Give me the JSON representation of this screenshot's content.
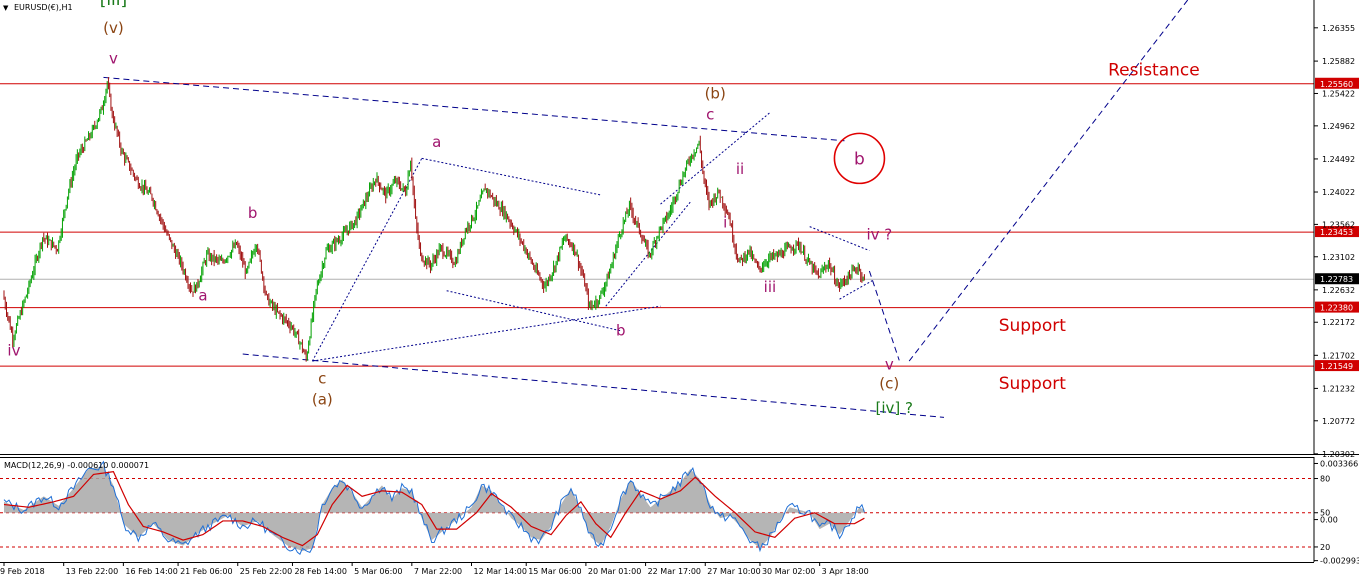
{
  "chart_data": {
    "type": "candlestick",
    "symbol_label": "EURUSD(€),H1",
    "colors": {
      "up_candle": "#00a000",
      "down_candle": "#a01010",
      "price_line": "#b0b0b0",
      "level_line": "#d00000",
      "trend_line": "#00008b",
      "wave_magenta": "#a0156e",
      "wave_brown": "#8b4513",
      "wave_green": "#1a7a1a",
      "macd_signal": "#d00000",
      "macd_main": "#1f6fd6",
      "macd_hist": "#a8a8a8"
    },
    "price_axis": {
      "range": [
        1.203,
        1.2675
      ],
      "ticks": [
        "1.26355",
        "1.25882",
        "1.25422",
        "1.24962",
        "1.24492",
        "1.24022",
        "1.23562",
        "1.23102",
        "1.22632",
        "1.22172",
        "1.21702",
        "1.21232",
        "1.20772",
        "1.20302"
      ]
    },
    "current_price": 1.22783,
    "current_price_label": "1.22783",
    "levels": [
      {
        "price": 1.2556,
        "label": "1.25560"
      },
      {
        "price": 1.23453,
        "label": "1.23453"
      },
      {
        "price": 1.2238,
        "label": "1.22380"
      },
      {
        "price": 1.21549,
        "label": "1.21549"
      }
    ],
    "zone_labels": [
      {
        "text": "Resistance",
        "price": 1.2568,
        "bar": 222
      },
      {
        "text": "Support",
        "price": 1.2205,
        "bar": 200
      },
      {
        "text": "Support",
        "price": 1.2122,
        "bar": 200
      }
    ],
    "time_axis": {
      "total_bars": 264,
      "ticks": [
        {
          "label": "9 Feb 2018",
          "bar": 0
        },
        {
          "label": "13 Feb 22:00",
          "bar": 12
        },
        {
          "label": "16 Feb 14:00",
          "bar": 24
        },
        {
          "label": "21 Feb 06:00",
          "bar": 35
        },
        {
          "label": "25 Feb 22:00",
          "bar": 47
        },
        {
          "label": "28 Feb 14:00",
          "bar": 58
        },
        {
          "label": "5 Mar 06:00",
          "bar": 70
        },
        {
          "label": "7 Mar 22:00",
          "bar": 82
        },
        {
          "label": "12 Mar 14:00",
          "bar": 94
        },
        {
          "label": "15 Mar 06:00",
          "bar": 105
        },
        {
          "label": "20 Mar 01:00",
          "bar": 117
        },
        {
          "label": "22 Mar 17:00",
          "bar": 129
        },
        {
          "label": "27 Mar 10:00",
          "bar": 141
        },
        {
          "label": "30 Mar 02:00",
          "bar": 152
        },
        {
          "label": "3 Apr 18:00",
          "bar": 164
        }
      ]
    },
    "price_path": [
      [
        0,
        1.2258
      ],
      [
        2,
        1.2195
      ],
      [
        5,
        1.2262
      ],
      [
        8,
        1.2338
      ],
      [
        11,
        1.2322
      ],
      [
        13,
        1.2398
      ],
      [
        15,
        1.2452
      ],
      [
        18,
        1.2488
      ],
      [
        20,
        1.2522
      ],
      [
        21,
        1.2558
      ],
      [
        22,
        1.2512
      ],
      [
        24,
        1.2458
      ],
      [
        27,
        1.2418
      ],
      [
        30,
        1.2395
      ],
      [
        33,
        1.2342
      ],
      [
        36,
        1.2298
      ],
      [
        38,
        1.2262
      ],
      [
        39,
        1.2268
      ],
      [
        41,
        1.2312
      ],
      [
        44,
        1.2302
      ],
      [
        47,
        1.2328
      ],
      [
        49,
        1.2286
      ],
      [
        51,
        1.2332
      ],
      [
        53,
        1.2252
      ],
      [
        55,
        1.2232
      ],
      [
        58,
        1.2212
      ],
      [
        60,
        1.2185
      ],
      [
        61,
        1.2165
      ],
      [
        63,
        1.2262
      ],
      [
        65,
        1.2318
      ],
      [
        68,
        1.2338
      ],
      [
        71,
        1.2362
      ],
      [
        73,
        1.2392
      ],
      [
        75,
        1.2422
      ],
      [
        77,
        1.2398
      ],
      [
        79,
        1.2418
      ],
      [
        81,
        1.2402
      ],
      [
        82,
        1.2448
      ],
      [
        83,
        1.2362
      ],
      [
        84,
        1.2312
      ],
      [
        86,
        1.2298
      ],
      [
        88,
        1.2322
      ],
      [
        91,
        1.2302
      ],
      [
        93,
        1.2348
      ],
      [
        95,
        1.2372
      ],
      [
        97,
        1.2408
      ],
      [
        99,
        1.2388
      ],
      [
        101,
        1.2372
      ],
      [
        103,
        1.2348
      ],
      [
        105,
        1.2322
      ],
      [
        107,
        1.2292
      ],
      [
        109,
        1.2268
      ],
      [
        111,
        1.2298
      ],
      [
        113,
        1.2338
      ],
      [
        115,
        1.2322
      ],
      [
        117,
        1.2272
      ],
      [
        118,
        1.2238
      ],
      [
        120,
        1.2252
      ],
      [
        122,
        1.2288
      ],
      [
        124,
        1.2342
      ],
      [
        126,
        1.2382
      ],
      [
        128,
        1.2348
      ],
      [
        130,
        1.2312
      ],
      [
        132,
        1.2348
      ],
      [
        134,
        1.2372
      ],
      [
        136,
        1.2412
      ],
      [
        138,
        1.2448
      ],
      [
        140,
        1.2472
      ],
      [
        141,
        1.2418
      ],
      [
        142,
        1.2385
      ],
      [
        144,
        1.2402
      ],
      [
        146,
        1.2368
      ],
      [
        147,
        1.2332
      ],
      [
        148,
        1.2302
      ],
      [
        150,
        1.2318
      ],
      [
        152,
        1.2292
      ],
      [
        154,
        1.2308
      ],
      [
        156,
        1.2312
      ],
      [
        158,
        1.2322
      ],
      [
        160,
        1.2328
      ],
      [
        162,
        1.2302
      ],
      [
        164,
        1.2282
      ],
      [
        166,
        1.2302
      ],
      [
        168,
        1.2268
      ],
      [
        170,
        1.2282
      ],
      [
        172,
        1.2296
      ],
      [
        173,
        1.2278
      ]
    ],
    "trend_lines": [
      {
        "style": "dashed",
        "from": [
          20,
          1.2565
        ],
        "to": [
          169,
          1.2475
        ]
      },
      {
        "style": "dashed",
        "from": [
          48,
          1.2172
        ],
        "to": [
          189,
          1.2082
        ]
      },
      {
        "style": "dotted",
        "from": [
          62,
          1.2162
        ],
        "to": [
          132,
          1.224
        ]
      },
      {
        "style": "dotted",
        "from": [
          62,
          1.2162
        ],
        "to": [
          84,
          1.245
        ]
      },
      {
        "style": "dotted",
        "from": [
          84,
          1.245
        ],
        "to": [
          120,
          1.2398
        ]
      },
      {
        "style": "dotted",
        "from": [
          89,
          1.2262
        ],
        "to": [
          124,
          1.2205
        ]
      },
      {
        "style": "dotted",
        "from": [
          121,
          1.224
        ],
        "to": [
          138,
          1.2388
        ]
      },
      {
        "style": "dotted",
        "from": [
          132,
          1.2385
        ],
        "to": [
          154,
          1.2515
        ]
      },
      {
        "style": "dotted",
        "from": [
          162,
          1.2353
        ],
        "to": [
          174,
          1.2319
        ]
      },
      {
        "style": "dotted",
        "from": [
          168,
          1.225
        ],
        "to": [
          175,
          1.2278
        ]
      },
      {
        "style": "dashed",
        "from": [
          174,
          1.229
        ],
        "to": [
          180,
          1.2163
        ]
      },
      {
        "style": "dashed",
        "from": [
          182,
          1.2162
        ],
        "to": [
          238,
          1.2675
        ]
      }
    ],
    "wave_labels": [
      {
        "text": "[iii]",
        "color": "green",
        "bar": 22,
        "price": 1.2668,
        "size": 17
      },
      {
        "text": "(v)",
        "color": "brown",
        "bar": 22,
        "price": 1.2628,
        "size": 15
      },
      {
        "text": "v",
        "color": "magenta",
        "bar": 22,
        "price": 1.2585,
        "size": 15
      },
      {
        "text": "iv",
        "color": "magenta",
        "bar": 2,
        "price": 1.217,
        "size": 15
      },
      {
        "text": "b",
        "color": "magenta",
        "bar": 50,
        "price": 1.2365,
        "size": 15
      },
      {
        "text": "a",
        "color": "magenta",
        "bar": 40,
        "price": 1.2248,
        "size": 15
      },
      {
        "text": "c",
        "color": "brown",
        "bar": 64,
        "price": 1.213,
        "size": 15
      },
      {
        "text": "(a)",
        "color": "brown",
        "bar": 64,
        "price": 1.21,
        "size": 15
      },
      {
        "text": "a",
        "color": "magenta",
        "bar": 87,
        "price": 1.2466,
        "size": 15
      },
      {
        "text": "b",
        "color": "magenta",
        "bar": 124,
        "price": 1.2198,
        "size": 15
      },
      {
        "text": "(b)",
        "color": "brown",
        "bar": 143,
        "price": 1.2535,
        "size": 15
      },
      {
        "text": "c",
        "color": "magenta",
        "bar": 142,
        "price": 1.2505,
        "size": 15
      },
      {
        "text": "ii",
        "color": "magenta",
        "bar": 148,
        "price": 1.2428,
        "size": 15
      },
      {
        "text": "i",
        "color": "magenta",
        "bar": 145,
        "price": 1.2352,
        "size": 15
      },
      {
        "text": "iii",
        "color": "magenta",
        "bar": 154,
        "price": 1.226,
        "size": 15
      },
      {
        "text": "iv ?",
        "color": "magenta",
        "bar": 176,
        "price": 1.2335,
        "size": 15
      },
      {
        "text": "v",
        "color": "magenta",
        "bar": 178,
        "price": 1.215,
        "size": 15
      },
      {
        "text": "(c)",
        "color": "brown",
        "bar": 178,
        "price": 1.2123,
        "size": 15
      },
      {
        "text": "[iv] ?",
        "color": "green",
        "bar": 179,
        "price": 1.2088,
        "size": 15
      }
    ],
    "circle_label": {
      "text": "b",
      "color": "magenta",
      "bar": 172,
      "price": 1.245
    },
    "macd": {
      "label": "MACD(12,26,9) -0.000610 0.000071",
      "axis_range": [
        -0.0036,
        0.004
      ],
      "axis_labels": [
        {
          "text": "0.003366",
          "value": 0.0036
        },
        {
          "text": "80",
          "value": 0.0025
        },
        {
          "text": "50",
          "value": 0.0
        },
        {
          "text": "0.00",
          "value": -0.0005
        },
        {
          "text": "20",
          "value": -0.0025
        },
        {
          "text": "-0.002993",
          "value": -0.0035
        }
      ],
      "dashed_levels": [
        0.0025,
        0.0,
        -0.0025
      ],
      "main_path": [
        [
          0,
          0.0008
        ],
        [
          4,
          0.0002
        ],
        [
          8,
          0.0012
        ],
        [
          11,
          0.0005
        ],
        [
          14,
          0.0018
        ],
        [
          17,
          0.0032
        ],
        [
          20,
          0.0034
        ],
        [
          22,
          0.002
        ],
        [
          24,
          -0.0008
        ],
        [
          27,
          -0.0018
        ],
        [
          30,
          -0.0008
        ],
        [
          33,
          -0.002
        ],
        [
          36,
          -0.0024
        ],
        [
          39,
          -0.0015
        ],
        [
          42,
          -0.0008
        ],
        [
          45,
          -0.0002
        ],
        [
          48,
          -0.001
        ],
        [
          51,
          -0.0006
        ],
        [
          54,
          -0.0016
        ],
        [
          57,
          -0.0024
        ],
        [
          60,
          -0.0028
        ],
        [
          62,
          -0.0026
        ],
        [
          64,
          0.0006
        ],
        [
          66,
          0.0018
        ],
        [
          68,
          0.0024
        ],
        [
          70,
          0.0015
        ],
        [
          72,
          0.0004
        ],
        [
          74,
          0.0012
        ],
        [
          76,
          0.002
        ],
        [
          78,
          0.001
        ],
        [
          80,
          0.0018
        ],
        [
          82,
          0.0016
        ],
        [
          84,
          -0.0004
        ],
        [
          86,
          -0.002
        ],
        [
          88,
          -0.0014
        ],
        [
          90,
          -0.0008
        ],
        [
          92,
          -0.0002
        ],
        [
          94,
          0.0004
        ],
        [
          96,
          0.002
        ],
        [
          98,
          0.0016
        ],
        [
          100,
          0.0006
        ],
        [
          102,
          -0.0004
        ],
        [
          104,
          -0.001
        ],
        [
          106,
          -0.0018
        ],
        [
          108,
          -0.002
        ],
        [
          110,
          -0.001
        ],
        [
          112,
          0.0006
        ],
        [
          114,
          0.0018
        ],
        [
          116,
          0.0002
        ],
        [
          118,
          -0.0018
        ],
        [
          120,
          -0.0024
        ],
        [
          122,
          -0.001
        ],
        [
          124,
          0.001
        ],
        [
          126,
          0.0024
        ],
        [
          128,
          0.0014
        ],
        [
          130,
          0.0004
        ],
        [
          132,
          0.001
        ],
        [
          134,
          0.0016
        ],
        [
          136,
          0.0022
        ],
        [
          138,
          0.0032
        ],
        [
          140,
          0.0024
        ],
        [
          142,
          0.0006
        ],
        [
          144,
          -0.0004
        ],
        [
          146,
          -0.0002
        ],
        [
          148,
          -0.001
        ],
        [
          150,
          -0.002
        ],
        [
          152,
          -0.0026
        ],
        [
          154,
          -0.0018
        ],
        [
          156,
          -0.0006
        ],
        [
          158,
          0.0004
        ],
        [
          160,
          0.0002
        ],
        [
          162,
          0.0
        ],
        [
          164,
          -0.0012
        ],
        [
          166,
          -0.0008
        ],
        [
          168,
          -0.0016
        ],
        [
          170,
          -0.0006
        ],
        [
          172,
          0.0004
        ],
        [
          173,
          0.0002
        ]
      ],
      "signal_path": [
        [
          0,
          0.0006
        ],
        [
          5,
          0.0004
        ],
        [
          10,
          0.0008
        ],
        [
          14,
          0.0012
        ],
        [
          18,
          0.0028
        ],
        [
          22,
          0.003
        ],
        [
          25,
          0.0006
        ],
        [
          28,
          -0.001
        ],
        [
          32,
          -0.0014
        ],
        [
          36,
          -0.002
        ],
        [
          40,
          -0.0016
        ],
        [
          44,
          -0.0006
        ],
        [
          48,
          -0.0006
        ],
        [
          52,
          -0.001
        ],
        [
          56,
          -0.0018
        ],
        [
          60,
          -0.0024
        ],
        [
          63,
          -0.0016
        ],
        [
          66,
          0.0006
        ],
        [
          69,
          0.002
        ],
        [
          72,
          0.0012
        ],
        [
          76,
          0.0016
        ],
        [
          80,
          0.0015
        ],
        [
          84,
          0.0006
        ],
        [
          87,
          -0.0012
        ],
        [
          91,
          -0.0012
        ],
        [
          95,
          0.0
        ],
        [
          98,
          0.0014
        ],
        [
          102,
          0.0004
        ],
        [
          106,
          -0.001
        ],
        [
          110,
          -0.0016
        ],
        [
          113,
          -0.0002
        ],
        [
          116,
          0.0008
        ],
        [
          119,
          -0.0008
        ],
        [
          122,
          -0.0018
        ],
        [
          125,
          0.0
        ],
        [
          128,
          0.0016
        ],
        [
          132,
          0.001
        ],
        [
          136,
          0.0016
        ],
        [
          139,
          0.0026
        ],
        [
          143,
          0.0012
        ],
        [
          147,
          0.0
        ],
        [
          151,
          -0.0014
        ],
        [
          155,
          -0.0018
        ],
        [
          159,
          -0.0004
        ],
        [
          163,
          0.0
        ],
        [
          167,
          -0.0008
        ],
        [
          171,
          -0.0008
        ],
        [
          173,
          -0.0004
        ]
      ]
    }
  }
}
